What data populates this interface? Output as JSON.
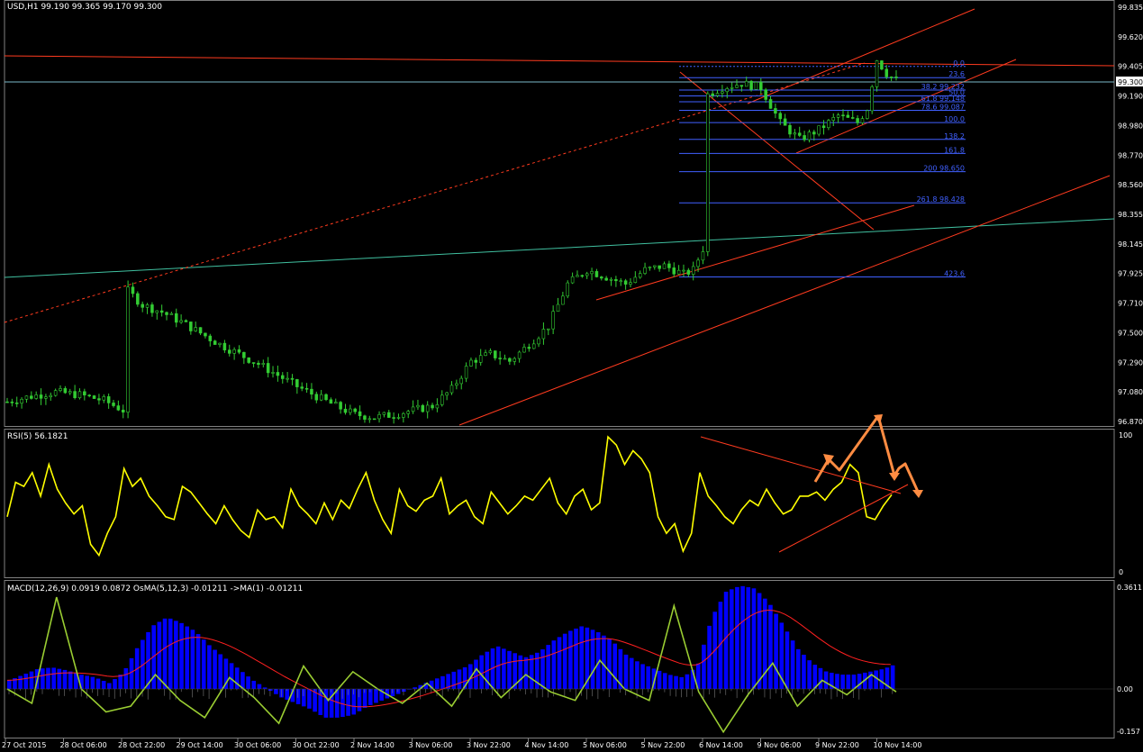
{
  "colors": {
    "background": "#000000",
    "grid_frame": "#808080",
    "candle": "#33cc33",
    "rsi": "#ffff00",
    "macd_hist": "#0000ff",
    "macd_signal": "#ff2020",
    "osma": "#9acd32",
    "trend_red": "#ff3b1f",
    "trend_teal": "#40c0a0",
    "fibo_blue": "#4060ff",
    "arrow_orange": "#ff8c42",
    "bid_line": "#7ab8c8"
  },
  "main": {
    "header": "USD,H1  99.190 99.365 99.170 99.300",
    "current_price_label": "99.300",
    "y_ticks": [
      "99.835",
      "99.620",
      "99.405",
      "99.190",
      "98.980",
      "98.770",
      "98.560",
      "98.355",
      "98.145",
      "97.925",
      "97.710",
      "97.500",
      "97.290",
      "97.080",
      "96.870"
    ],
    "fibo_labels": [
      "0.0",
      "23.6",
      "38.2 99.232",
      "50.0",
      "61.8 99.148",
      "78.6 99.087",
      "100.0",
      "138.2",
      "161.8",
      "200 98.650",
      "261.8 98.428",
      "423.6"
    ]
  },
  "rsi": {
    "header": "RSI(5) 56.1821",
    "y_ticks": [
      "100",
      "0"
    ]
  },
  "macd": {
    "header": "MACD(12,26,9) 0.0919 0.0872  OsMA(5,12,3) -0.01211  ->MA(1) -0.01211",
    "y_ticks": [
      "0.3611",
      "0.00",
      "-0.157"
    ]
  },
  "x_axis": {
    "labels": [
      "27 Oct 2015",
      "28 Oct 06:00",
      "28 Oct 22:00",
      "29 Oct 14:00",
      "30 Oct 06:00",
      "30 Oct 22:00",
      "2 Nov 14:00",
      "3 Nov 06:00",
      "3 Nov 22:00",
      "4 Nov 14:00",
      "5 Nov 06:00",
      "5 Nov 22:00",
      "6 Nov 14:00",
      "9 Nov 06:00",
      "9 Nov 22:00",
      "10 Nov 14:00"
    ]
  },
  "chart_data": [
    {
      "type": "candlestick",
      "title": "USD,H1",
      "ohlc_last": {
        "open": 99.19,
        "high": 99.365,
        "low": 99.17,
        "close": 99.3
      },
      "ylim": [
        96.87,
        99.835
      ],
      "price_path": [
        [
          0,
          97.01
        ],
        [
          5,
          97.05
        ],
        [
          10,
          97.08
        ],
        [
          15,
          97.06
        ],
        [
          20,
          97.02
        ],
        [
          24,
          96.95
        ],
        [
          25,
          97.8
        ],
        [
          28,
          97.7
        ],
        [
          32,
          97.65
        ],
        [
          36,
          97.58
        ],
        [
          40,
          97.5
        ],
        [
          44,
          97.42
        ],
        [
          48,
          97.35
        ],
        [
          52,
          97.28
        ],
        [
          56,
          97.2
        ],
        [
          60,
          97.12
        ],
        [
          64,
          97.05
        ],
        [
          68,
          96.98
        ],
        [
          72,
          96.92
        ],
        [
          76,
          96.9
        ],
        [
          80,
          96.92
        ],
        [
          84,
          96.95
        ],
        [
          88,
          96.98
        ],
        [
          92,
          97.1
        ],
        [
          96,
          97.3
        ],
        [
          100,
          97.35
        ],
        [
          104,
          97.3
        ],
        [
          108,
          97.42
        ],
        [
          112,
          97.55
        ],
        [
          116,
          97.85
        ],
        [
          120,
          97.95
        ],
        [
          124,
          97.9
        ],
        [
          128,
          97.85
        ],
        [
          132,
          97.95
        ],
        [
          136,
          97.98
        ],
        [
          140,
          97.92
        ],
        [
          142,
          97.95
        ],
        [
          144,
          98.1
        ],
        [
          145,
          99.2
        ],
        [
          148,
          99.25
        ],
        [
          152,
          99.28
        ],
        [
          156,
          99.25
        ],
        [
          160,
          99.0
        ],
        [
          164,
          98.88
        ],
        [
          168,
          98.95
        ],
        [
          172,
          99.05
        ],
        [
          176,
          99.0
        ],
        [
          178,
          99.1
        ],
        [
          180,
          99.45
        ],
        [
          182,
          99.35
        ],
        [
          184,
          99.3
        ]
      ],
      "candles_count": 185,
      "fibonacci_retracement": {
        "levels": [
          0.0,
          23.6,
          38.2,
          50.0,
          61.8,
          78.6,
          100.0,
          138.2,
          161.8,
          200,
          261.8,
          423.6
        ],
        "prices": [
          99.4,
          99.32,
          99.232,
          99.19,
          99.148,
          99.087,
          99.0,
          98.88,
          98.78,
          98.65,
          98.428,
          97.9
        ]
      }
    },
    {
      "type": "line",
      "title": "RSI(5) 56.1821",
      "ylim": [
        0,
        100
      ],
      "series": [
        {
          "name": "RSI(5)",
          "values": [
            40,
            65,
            62,
            72,
            55,
            78,
            60,
            50,
            42,
            48,
            20,
            12,
            28,
            40,
            75,
            62,
            68,
            55,
            48,
            40,
            38,
            62,
            58,
            50,
            42,
            35,
            48,
            38,
            30,
            25,
            45,
            38,
            40,
            32,
            60,
            48,
            42,
            35,
            50,
            38,
            52,
            46,
            60,
            72,
            52,
            38,
            28,
            60,
            48,
            44,
            52,
            55,
            68,
            42,
            48,
            52,
            40,
            35,
            58,
            50,
            42,
            48,
            55,
            52,
            60,
            68,
            50,
            42,
            55,
            60,
            45,
            50,
            98,
            92,
            78,
            88,
            82,
            72,
            40,
            28,
            35,
            15,
            28,
            72,
            55,
            48,
            40,
            35,
            45,
            52,
            48,
            60,
            50,
            42,
            45,
            55,
            55,
            58,
            52,
            60,
            65,
            78,
            72,
            40,
            38,
            48,
            56
          ]
        }
      ]
    },
    {
      "type": "bar",
      "title": "MACD(12,26,9) 0.0919 0.0872",
      "ylim": [
        -0.157,
        0.3611
      ],
      "series": [
        {
          "name": "MACD(12,26,9)",
          "values": [
            0.03,
            0.05,
            0.07,
            0.075,
            0.065,
            0.05,
            0.04,
            0.02,
            0.06,
            0.15,
            0.22,
            0.25,
            0.23,
            0.2,
            0.15,
            0.11,
            0.07,
            0.03,
            0.0,
            -0.03,
            -0.05,
            -0.07,
            -0.1,
            -0.1,
            -0.09,
            -0.06,
            -0.04,
            -0.02,
            0.0,
            0.02,
            0.04,
            0.06,
            0.08,
            0.12,
            0.15,
            0.13,
            0.11,
            0.13,
            0.17,
            0.2,
            0.22,
            0.2,
            0.17,
            0.12,
            0.09,
            0.07,
            0.05,
            0.04,
            0.08,
            0.25,
            0.34,
            0.36,
            0.35,
            0.3,
            0.22,
            0.14,
            0.09,
            0.06,
            0.05,
            0.05,
            0.06,
            0.07,
            0.09
          ]
        },
        {
          "name": "OsMA(5,12,3)",
          "values": [
            0.0,
            -0.05,
            0.32,
            0.0,
            -0.08,
            -0.06,
            0.05,
            -0.04,
            -0.1,
            0.04,
            -0.03,
            -0.12,
            0.08,
            -0.04,
            0.06,
            0.0,
            -0.05,
            0.02,
            -0.06,
            0.07,
            -0.03,
            0.05,
            -0.01,
            -0.04,
            0.1,
            0.0,
            -0.04,
            0.29,
            -0.01,
            -0.15,
            -0.02,
            0.09,
            -0.06,
            0.03,
            -0.02,
            0.05,
            -0.01
          ]
        }
      ]
    }
  ]
}
